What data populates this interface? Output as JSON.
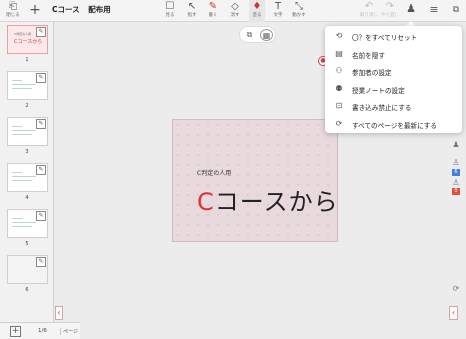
{
  "toolbar": {
    "close_label": "閉じる",
    "course_name": "Cコース",
    "distribution": "配布用",
    "tools": [
      {
        "icon": "view-icon",
        "label": "見る"
      },
      {
        "icon": "pointer-icon",
        "label": "指す"
      },
      {
        "icon": "pen-icon",
        "label": "書く"
      },
      {
        "icon": "eraser-icon",
        "label": "消す"
      },
      {
        "icon": "marker-icon",
        "label": "塗る"
      },
      {
        "icon": "text-icon",
        "label": "文字"
      },
      {
        "icon": "move-icon",
        "label": "動かす"
      }
    ],
    "undo_label": "取り消し",
    "redo_label": "やり直し"
  },
  "sidebar": {
    "thumb1_small": "C判定の人用",
    "thumb1_text": "Cコースから",
    "page_numbers": [
      "1",
      "2",
      "3",
      "4",
      "5",
      "6"
    ]
  },
  "footer": {
    "page_counter": "1/6",
    "page_label": "ページ"
  },
  "slide": {
    "subtitle": "C判定の人用",
    "title_accent": "C",
    "title_rest": "コースから",
    "accent_color": "#e0303c"
  },
  "menu": {
    "items": [
      {
        "icon": "reset-icon",
        "label": "〇？をすべてリセット"
      },
      {
        "icon": "name-card-icon",
        "label": "名前を隠す"
      },
      {
        "icon": "participants-icon",
        "label": "参加者の設定"
      },
      {
        "icon": "class-note-icon",
        "label": "授業ノートの設定"
      },
      {
        "icon": "lock-icon",
        "label": "書き込み禁止にする"
      },
      {
        "icon": "refresh-pages-icon",
        "label": "すべてのページを最新にする"
      }
    ]
  },
  "rail": {
    "badge_blue": "6",
    "badge_red": "0"
  }
}
